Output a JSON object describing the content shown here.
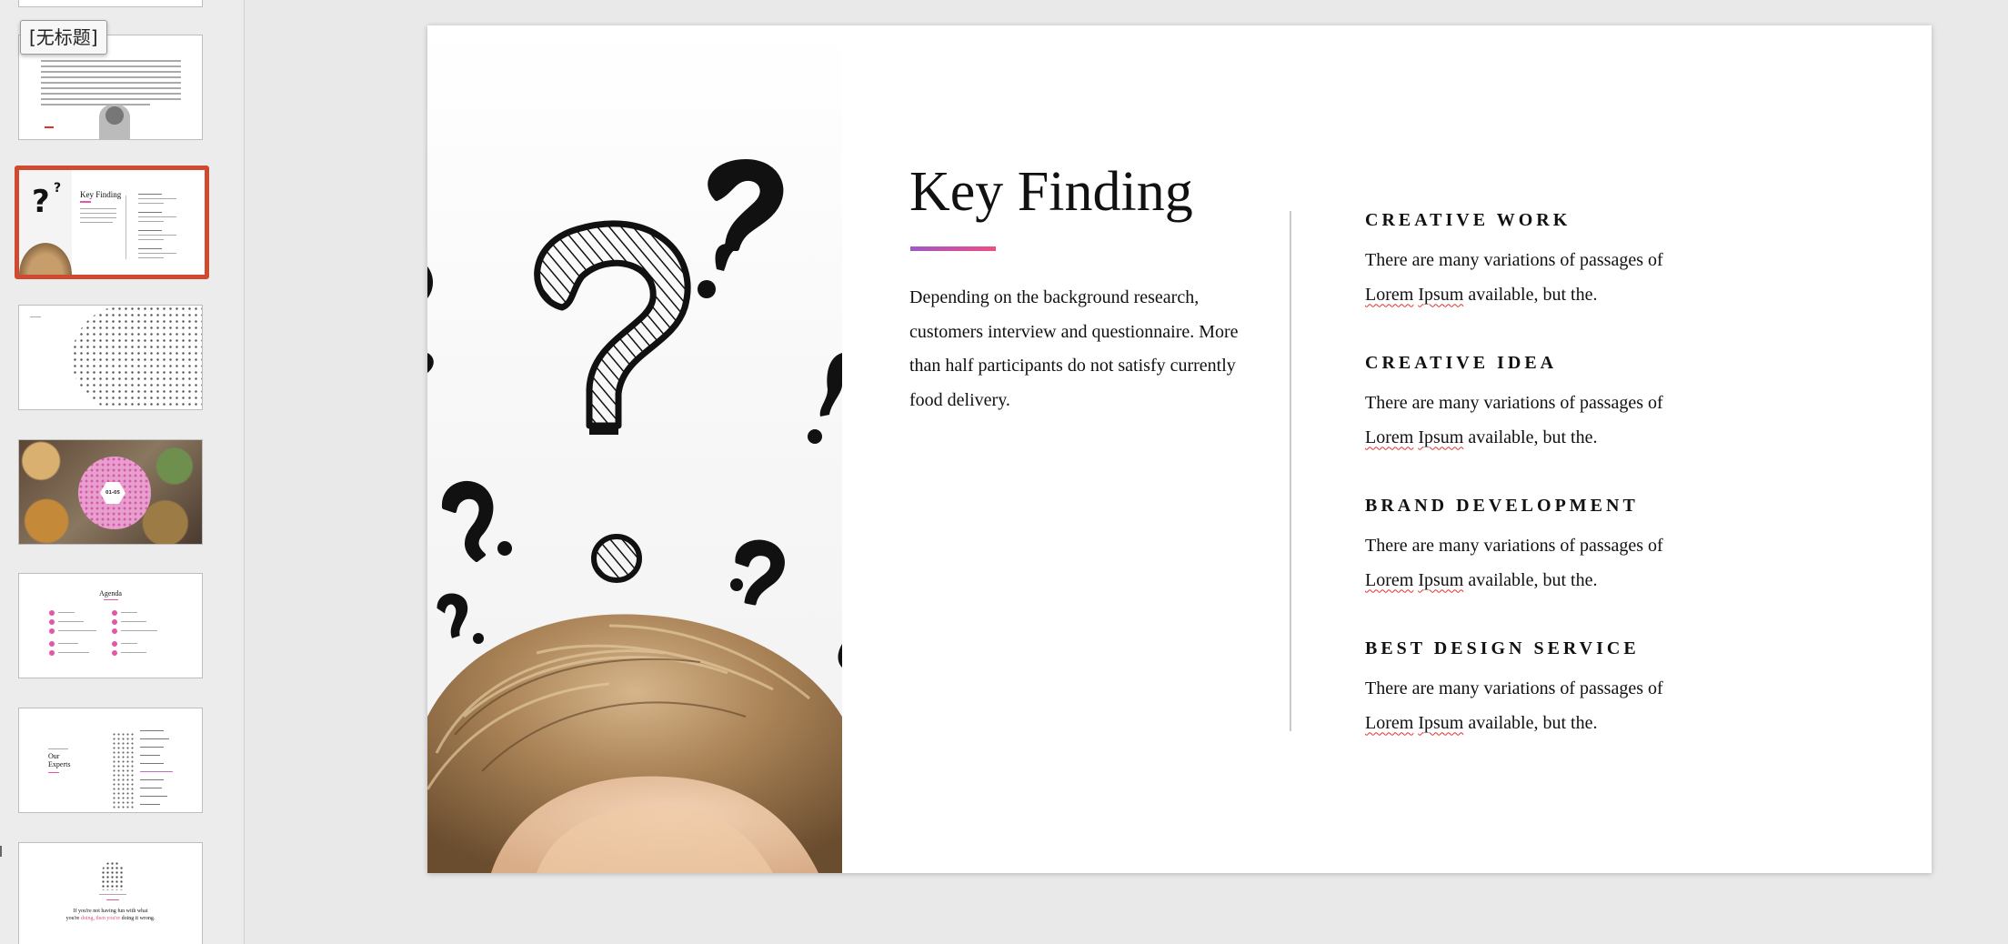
{
  "sidebar": {
    "tooltip": "[无标题]",
    "thumb_selected": {
      "title": "Key Finding"
    },
    "thumb_agenda": {
      "title": "Agenda"
    },
    "thumb_experts": {
      "title_line1": "Our",
      "title_line2": "Experts"
    },
    "thumb_quote": {
      "line1": "If you're not having fun with what",
      "line2_a": "you're",
      "line2_b": "doing, then you're",
      "line2_c": "doing it wrong."
    },
    "thumb_food": {
      "badge": "01-05"
    }
  },
  "slide": {
    "title": "Key Finding",
    "intro": "Depending on the background research, customers interview and questionnaire. More than half participants do not satisfy currently food delivery.",
    "items": [
      {
        "heading": "CREATIVE WORK",
        "text_a": "There are many variations of passages of",
        "spell1": "Lorem",
        "spell2": "Ipsum",
        "text_b": "available, but the."
      },
      {
        "heading": "CREATIVE IDEA",
        "text_a": "There are many variations of passages of",
        "spell1": "Lorem",
        "spell2": "Ipsum",
        "text_b": "available, but the."
      },
      {
        "heading": "BRAND DEVELOPMENT",
        "text_a": "There are many variations of passages of",
        "spell1": "Lorem",
        "spell2": "Ipsum",
        "text_b": "available, but the."
      },
      {
        "heading": "BEST DESIGN SERVICE",
        "text_a": "There are many variations of passages of",
        "spell1": "Lorem",
        "spell2": "Ipsum",
        "text_b": "available, but the."
      }
    ]
  },
  "colors": {
    "selection_border": "#cf4a2f",
    "accent_gradient_start": "#a158c6",
    "accent_gradient_end": "#ee4d86",
    "spellcheck": "#e0312c"
  }
}
